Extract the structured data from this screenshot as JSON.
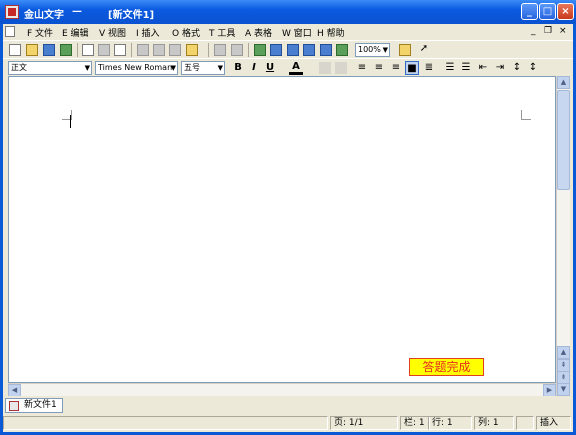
{
  "window": {
    "app_title": "金山文字",
    "dash": "—",
    "doc_title": "[新文件1]",
    "buttons": {
      "minimize": "_",
      "maximize": "□",
      "close": "×"
    }
  },
  "menu": {
    "items": [
      {
        "label": "F 文件"
      },
      {
        "label": "E 编辑"
      },
      {
        "label": "V 视图"
      },
      {
        "label": "I 插入"
      },
      {
        "label": "O 格式"
      },
      {
        "label": "T 工具"
      },
      {
        "label": "A 表格"
      },
      {
        "label": "W 窗口"
      },
      {
        "label": "H 帮助"
      }
    ],
    "mdi": {
      "minimize": "_",
      "restore": "❐",
      "close": "×"
    }
  },
  "toolbar": {
    "zoom": "100%"
  },
  "format_bar": {
    "style": "正文",
    "font": "Times New Roman",
    "size": "五号",
    "bold": "B",
    "italic": "I",
    "underline": "U",
    "font_color": "A"
  },
  "document": {
    "done_label": "答题完成"
  },
  "tabs": [
    {
      "label": "新文件1"
    }
  ],
  "status": {
    "page": "页: 1/1",
    "column": "栏: 1",
    "line": "行: 1",
    "col": "列: 1",
    "mode": "插入"
  }
}
